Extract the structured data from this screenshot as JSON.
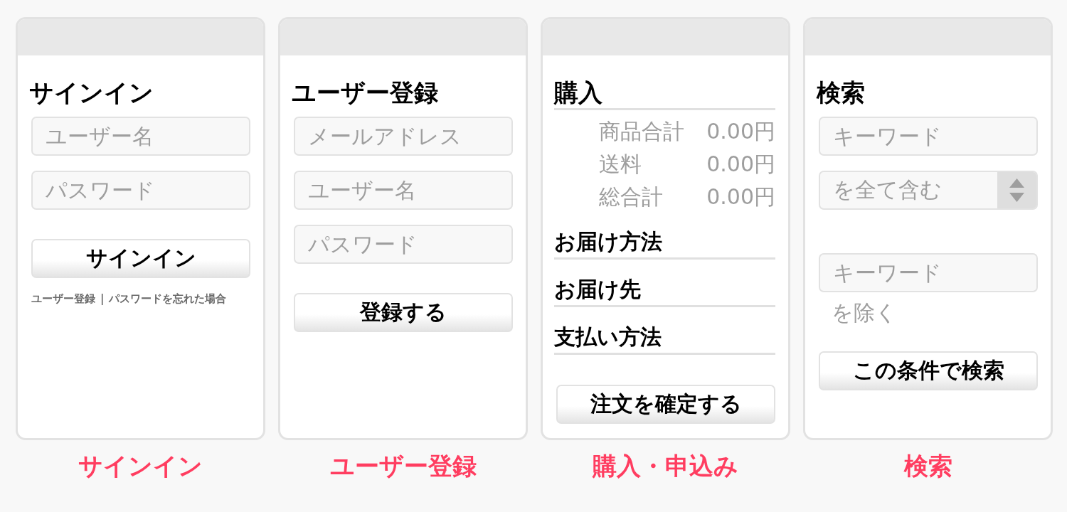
{
  "screens": [
    {
      "title": "サインイン",
      "title_underlined": false,
      "items": [
        {
          "kind": "field",
          "placeholder": "ユーザー名"
        },
        {
          "kind": "field",
          "placeholder": "パスワード"
        },
        {
          "kind": "button",
          "label": "サインイン"
        },
        {
          "kind": "links",
          "links": [
            "ユーザー登録",
            "パスワードを忘れた場合"
          ],
          "separator": "|"
        }
      ],
      "caption": "サインイン"
    },
    {
      "title": "ユーザー登録",
      "title_underlined": false,
      "items": [
        {
          "kind": "field",
          "placeholder": "メールアドレス"
        },
        {
          "kind": "field",
          "placeholder": "ユーザー名"
        },
        {
          "kind": "field",
          "placeholder": "パスワード"
        },
        {
          "kind": "button",
          "label": "登録する"
        }
      ],
      "caption": "ユーザー登録"
    },
    {
      "title": "購入",
      "title_underlined": true,
      "items": [
        {
          "kind": "summary",
          "rows": [
            {
              "label": "商品合計",
              "value": "0.00円"
            },
            {
              "label": "送料",
              "value": "0.00円"
            },
            {
              "label": "総合計",
              "value": "0.00円"
            }
          ]
        },
        {
          "kind": "section",
          "label": "お届け方法"
        },
        {
          "kind": "section",
          "label": "お届け先"
        },
        {
          "kind": "section",
          "label": "支払い方法"
        },
        {
          "kind": "button",
          "label": "注文を確定する"
        }
      ],
      "caption": "購入・申込み"
    },
    {
      "title": "検索",
      "title_underlined": false,
      "items": [
        {
          "kind": "field",
          "placeholder": "キーワード"
        },
        {
          "kind": "select",
          "value": "を全て含む"
        },
        {
          "kind": "field",
          "placeholder": "キーワード"
        },
        {
          "kind": "note",
          "text": "を除く"
        },
        {
          "kind": "button",
          "label": "この条件で検索"
        }
      ],
      "caption": "検索"
    }
  ]
}
